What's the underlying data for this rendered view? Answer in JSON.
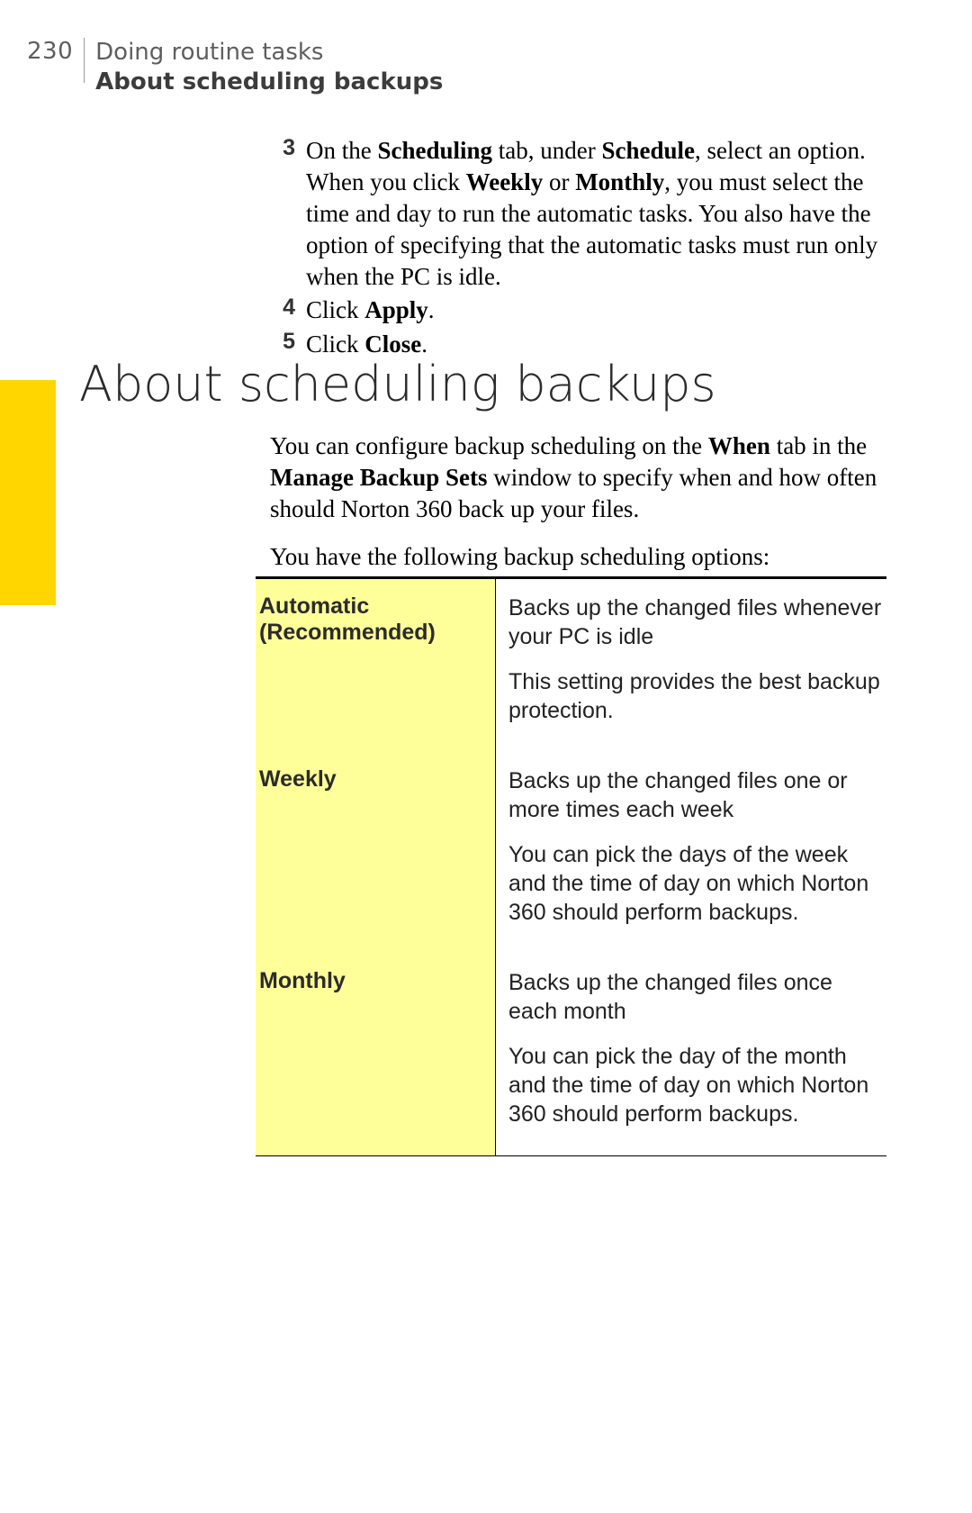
{
  "header": {
    "pagenum": "230",
    "chapter": "Doing routine tasks",
    "section": "About scheduling backups"
  },
  "steps": [
    {
      "num": "3",
      "html": "On the <b>Scheduling</b> tab, under <b>Schedule</b>, select an option.<br>When you click <b>Weekly</b> or <b>Monthly</b>, you must select the time and day to run the automatic tasks. You also have the option of specifying that the automatic tasks must run only when the PC is idle."
    },
    {
      "num": "4",
      "html": "Click <b>Apply</b>."
    },
    {
      "num": "5",
      "html": "Click <b>Close</b>."
    }
  ],
  "section_heading": "About scheduling backups",
  "intro": [
    "You can configure backup scheduling on the <b>When</b> tab in the <b>Manage Backup Sets</b> window to specify when and how often should Norton 360 back up your files.",
    "You have the following backup scheduling options:"
  ],
  "options": [
    {
      "name": "Automatic (Recommended)",
      "desc": [
        "Backs up the changed files whenever your PC is idle",
        "This setting provides the best backup protection."
      ]
    },
    {
      "name": "Weekly",
      "desc": [
        "Backs up the changed files one or more times each week",
        "You can pick the days of the week and the time of day on which Norton 360 should perform backups."
      ]
    },
    {
      "name": "Monthly",
      "desc": [
        "Backs up the changed files once each month",
        "You can pick the day of the month and the time of day on which Norton 360 should perform backups."
      ]
    }
  ]
}
